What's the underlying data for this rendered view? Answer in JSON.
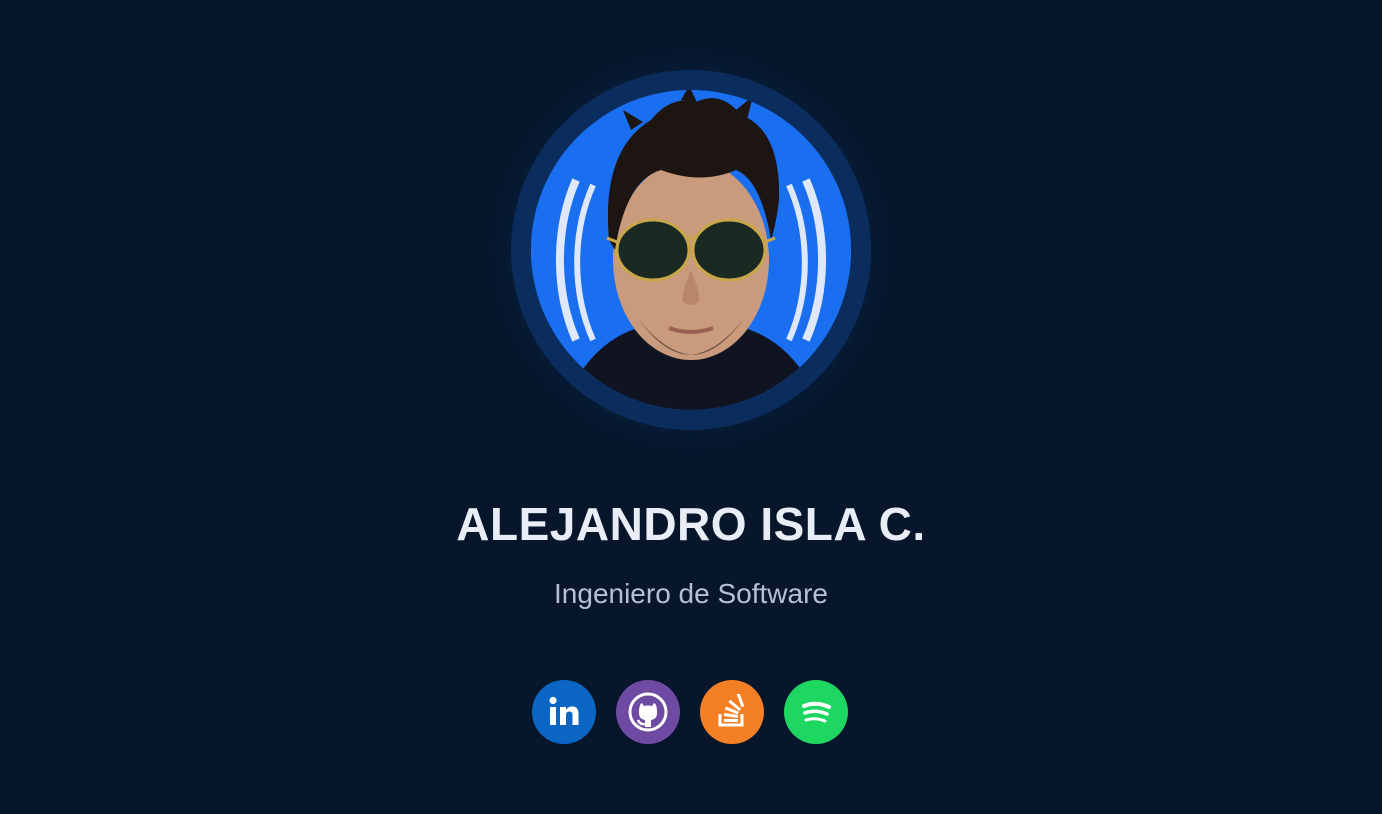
{
  "profile": {
    "name": "ALEJANDRO ISLA C.",
    "title": "Ingeniero de Software"
  },
  "social_links": [
    {
      "icon": "linkedin-icon",
      "color": "#0a66c2"
    },
    {
      "icon": "github-icon",
      "color": "#6e4aa3"
    },
    {
      "icon": "stackoverflow-icon",
      "color": "#f47f24"
    },
    {
      "icon": "spotify-icon",
      "color": "#1ed760"
    }
  ],
  "colors": {
    "background": "#07162a",
    "avatar_ring": "#0a2d5e",
    "avatar_bg": "#1a6ff0",
    "name": "#e9edf5",
    "subtitle": "#b6c0d2"
  }
}
